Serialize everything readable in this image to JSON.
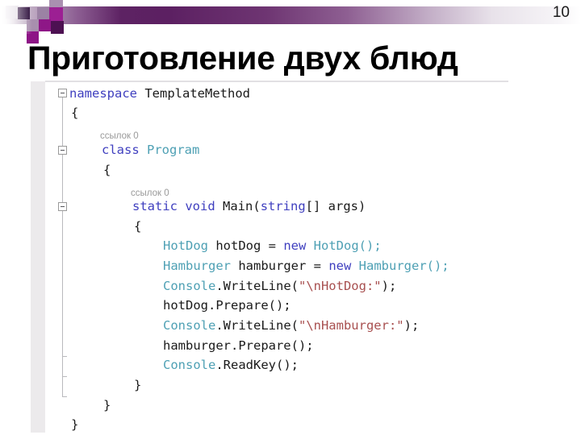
{
  "slide": {
    "page_number": "10",
    "title": "Приготовление двух блюд",
    "accent_color": "#5c2062",
    "title_color": "#000000"
  },
  "code_editor": {
    "language": "C#",
    "background": "#ffffff",
    "gutter_color": "#eceaec",
    "keyword_color": "#3f3fbf",
    "type_color": "#4ea0b4",
    "string_color": "#a85050",
    "text_color": "#1a1a1a",
    "codelens_color": "#9a9a9a",
    "codelens": {
      "class_program": "ссылок 0",
      "method_main": "ссылок 0"
    },
    "lines": [
      {
        "indent": 0,
        "text": "namespace TemplateMethod"
      },
      {
        "indent": 1,
        "text": "{"
      },
      {
        "indent": 2,
        "text": "class Program"
      },
      {
        "indent": 2,
        "text": "{"
      },
      {
        "indent": 3,
        "text": "static void Main(string[] args)"
      },
      {
        "indent": 3,
        "text": "{"
      },
      {
        "indent": 4,
        "text": "HotDog hotDog = new HotDog();"
      },
      {
        "indent": 4,
        "text": "Hamburger hamburger = new Hamburger();"
      },
      {
        "indent": 4,
        "text": "Console.WriteLine(\"\\nHotDog:\");"
      },
      {
        "indent": 4,
        "text": "hotDog.Prepare();"
      },
      {
        "indent": 4,
        "text": "Console.WriteLine(\"\\nHamburger:\");"
      },
      {
        "indent": 4,
        "text": "hamburger.Prepare();"
      },
      {
        "indent": 4,
        "text": "Console.ReadKey();"
      },
      {
        "indent": 3,
        "text": "}"
      },
      {
        "indent": 2,
        "text": "}"
      },
      {
        "indent": 1,
        "text": "}"
      }
    ],
    "tokens": {
      "namespace": "namespace",
      "template_method": "TemplateMethod",
      "brace_open": "{",
      "brace_close": "}",
      "class": "class",
      "program": "Program",
      "static": "static",
      "void": "void",
      "main_sig": "Main(",
      "string": "string",
      "args_sig": "[] args)",
      "hotdog_type": "HotDog",
      "hotdog_var": " hotDog = ",
      "new": "new",
      "hotdog_ctor": " HotDog();",
      "hamburger_type": "Hamburger",
      "hamburger_var": " hamburger = ",
      "hamburger_ctor": " Hamburger();",
      "console": "Console",
      "writeline_open": ".WriteLine(",
      "str_hotdog": "\"\\nHotDog:\"",
      "str_hamburger": "\"\\nHamburger:\"",
      "paren_semi": ");",
      "hotdog_prepare": "hotDog.Prepare();",
      "hamburger_prepare": "hamburger.Prepare();",
      "readkey": ".ReadKey();"
    }
  }
}
